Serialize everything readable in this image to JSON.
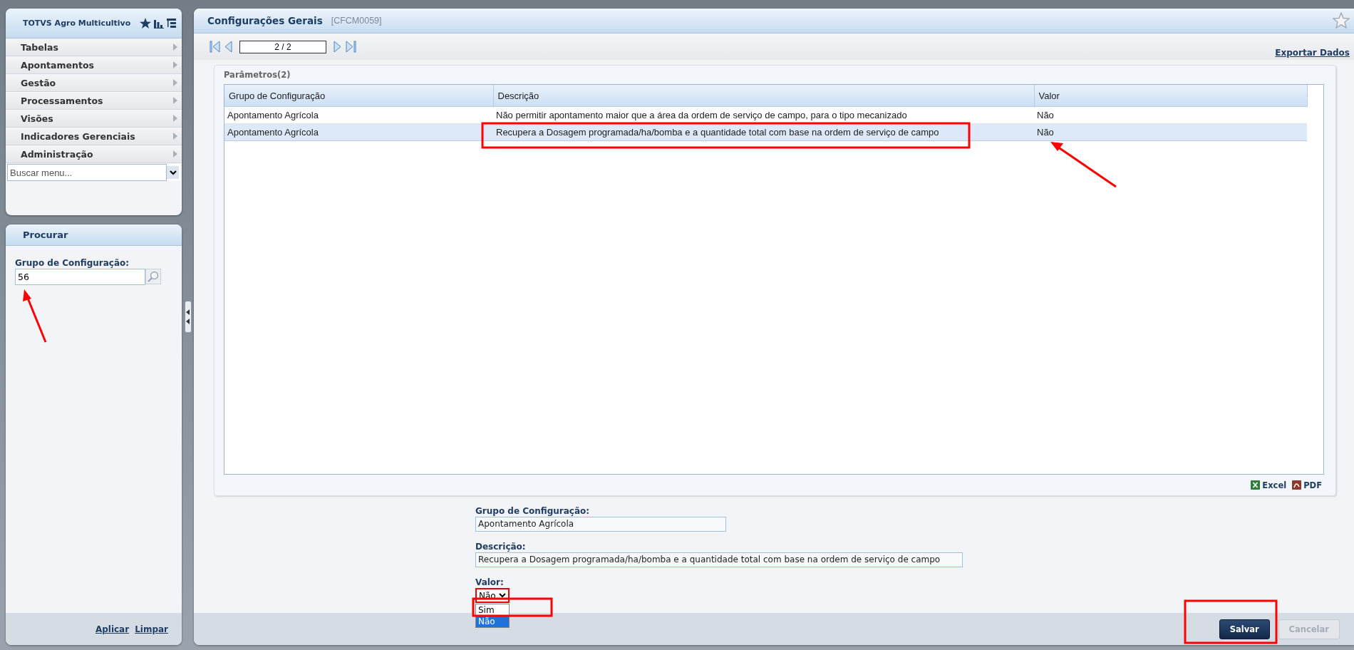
{
  "sidebar": {
    "title": "TOTVS Agro Multicultivo",
    "menu": [
      {
        "label": "Tabelas"
      },
      {
        "label": "Apontamentos"
      },
      {
        "label": "Gestão"
      },
      {
        "label": "Processamentos"
      },
      {
        "label": "Visões"
      },
      {
        "label": "Indicadores Gerenciais"
      },
      {
        "label": "Administração"
      }
    ],
    "menu_search": {
      "placeholder": "Buscar menu..."
    }
  },
  "search_panel": {
    "title": "Procurar",
    "field_label": "Grupo de Configuração:",
    "field_value": "56",
    "actions": [
      "Aplicar",
      "Limpar"
    ]
  },
  "page": {
    "title": "Configurações Gerais",
    "code": "[CFCM0059]",
    "pager": "2 / 2",
    "export_link": "Exportar Dados"
  },
  "table": {
    "title": "Parâmetros(2)",
    "columns": [
      "Grupo de Configuração",
      "Descrição",
      "Valor"
    ],
    "rows": [
      {
        "cells": [
          "Apontamento Agrícola",
          "Não permitir apontamento maior que a área da ordem de serviço de campo, para o tipo mecanizado",
          "Não"
        ],
        "selected": false
      },
      {
        "cells": [
          "Apontamento Agrícola",
          "Recupera a Dosagem programada/ha/bomba e a quantidade total com base na ordem de serviço de campo",
          "Não"
        ],
        "selected": true
      }
    ]
  },
  "exports": [
    "Excel",
    "PDF"
  ],
  "form": {
    "fields": [
      {
        "kind": "text",
        "label": "Grupo de Configuração:",
        "value": "Apontamento Agrícola"
      },
      {
        "kind": "text",
        "label": "Descrição:",
        "value": "Recupera a Dosagem programada/ha/bomba e a quantidade total com base na ordem de serviço de campo"
      },
      {
        "kind": "select",
        "label": "Valor:",
        "value": "Não",
        "options": [
          {
            "label": "Sim",
            "selected": false
          },
          {
            "label": "Não",
            "selected": true
          }
        ]
      }
    ]
  },
  "buttons": [
    {
      "label": "Salvar",
      "disabled": false
    },
    {
      "label": "Cancelar",
      "disabled": true
    }
  ]
}
